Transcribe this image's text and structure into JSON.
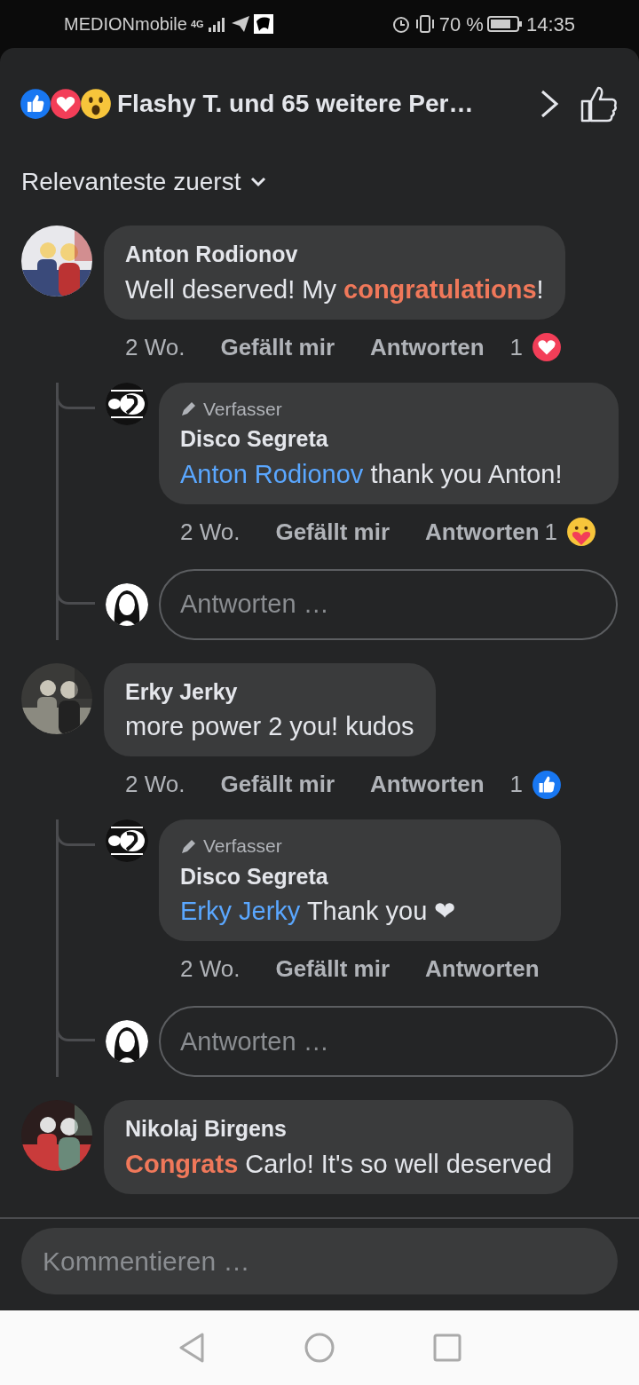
{
  "status_bar": {
    "carrier": "MEDIONmobile",
    "network": "4G",
    "battery": "70 %",
    "time": "14:35"
  },
  "header": {
    "reactions": [
      {
        "kind": "like"
      },
      {
        "kind": "love"
      },
      {
        "kind": "wow"
      }
    ],
    "title": "Flashy T. und 65 weitere Per…",
    "liked": false
  },
  "sort": {
    "label": "Relevanteste zuerst"
  },
  "comments": [
    {
      "author": "Anton Rodionov",
      "text": "Well deserved! My **congratulations**!",
      "time": "2 Wo.",
      "like": "Gefällt mir",
      "reply": "Antworten",
      "reaction": {
        "count": "1",
        "kind": "love"
      },
      "replies": [
        {
          "badge": "Verfasser",
          "author": "Disco Segreta",
          "mention": "Anton Rodionov",
          "text": "thank you Anton!",
          "time": "2 Wo.",
          "like": "Gefällt mir",
          "reply": "Antworten",
          "reaction": {
            "count": "1",
            "kind": "care"
          }
        }
      ],
      "reply_placeholder": "Antworten …"
    },
    {
      "author": "Erky Jerky",
      "text": "more power 2 you! kudos",
      "time": "2 Wo.",
      "like": "Gefällt mir",
      "reply": "Antworten",
      "reaction": {
        "count": "1",
        "kind": "like"
      },
      "replies": [
        {
          "badge": "Verfasser",
          "author": "Disco Segreta",
          "mention": "Erky Jerky",
          "text": "Thank you ❤",
          "time": "2 Wo.",
          "like": "Gefällt mir",
          "reply": "Antworten"
        }
      ],
      "reply_placeholder": "Antworten …"
    },
    {
      "author": "Nikolaj Birgens",
      "text": "**Congrats** Carlo! It's so well deserved"
    }
  ],
  "composer": {
    "placeholder": "Kommentieren …"
  }
}
